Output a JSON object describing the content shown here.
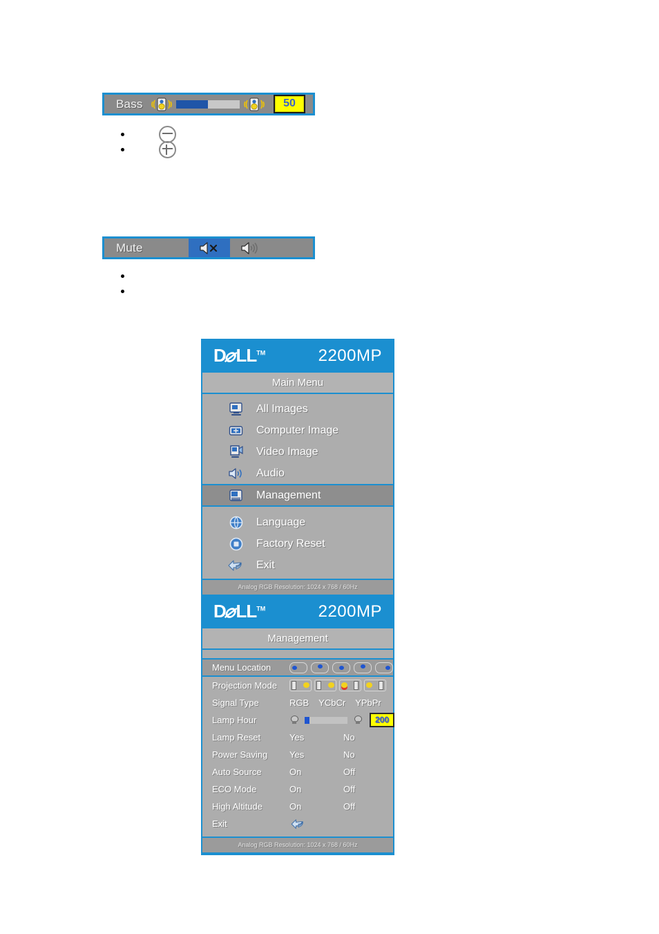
{
  "bass_control": {
    "label": "Bass",
    "value": "50",
    "fill_percent": 50,
    "left_icon": "bass-speaker-icon",
    "right_icon": "bass-speaker-icon"
  },
  "bass_bullets": [
    {
      "icon": "minus-circle-icon",
      "text": ""
    },
    {
      "icon": "plus-circle-icon",
      "text": ""
    }
  ],
  "mute_control": {
    "label": "Mute",
    "options": [
      {
        "icon": "speaker-muted-icon",
        "selected": true
      },
      {
        "icon": "speaker-on-icon",
        "selected": false
      }
    ]
  },
  "mute_bullets": [
    {
      "text": ""
    },
    {
      "text": ""
    }
  ],
  "main_menu_panel": {
    "brand": "D∕LL",
    "brand_tm": "TM",
    "model": "2200MP",
    "title": "Main Menu",
    "items": [
      {
        "label": "All Images",
        "icon": "monitor-icon",
        "selected": false
      },
      {
        "label": "Computer Image",
        "icon": "computer-image-icon",
        "selected": false
      },
      {
        "label": "Video Image",
        "icon": "video-image-icon",
        "selected": false
      },
      {
        "label": "Audio",
        "icon": "speaker-icon",
        "selected": false
      },
      {
        "label": "Management",
        "icon": "management-icon",
        "selected": true
      },
      {
        "label": "Language",
        "icon": "globe-icon",
        "selected": false
      },
      {
        "label": "Factory Reset",
        "icon": "factory-reset-icon",
        "selected": false
      },
      {
        "label": "Exit",
        "icon": "exit-arrow-icon",
        "selected": false
      }
    ],
    "footer": "Analog RGB Resolution: 1024 x 768 / 60Hz"
  },
  "management_panel": {
    "brand": "D∕LL",
    "brand_tm": "TM",
    "model": "2200MP",
    "title": "Management",
    "rows": [
      {
        "label": "Menu Location",
        "type": "location-icons",
        "selected": true
      },
      {
        "label": "Projection Mode",
        "type": "projection-icons",
        "selected": false
      },
      {
        "label": "Signal Type",
        "type": "signal",
        "options": [
          "RGB",
          "YCbCr",
          "YPbPr"
        ],
        "selected": false
      },
      {
        "label": "Lamp Hour",
        "type": "lamp",
        "value": "200",
        "fill_percent": 12,
        "selected": false
      },
      {
        "label": "Lamp Reset",
        "type": "two-option",
        "options": [
          "Yes",
          "No"
        ],
        "selected": false
      },
      {
        "label": "Power Saving",
        "type": "two-option",
        "options": [
          "Yes",
          "No"
        ],
        "selected": false
      },
      {
        "label": "Auto Source",
        "type": "two-option",
        "options": [
          "On",
          "Off"
        ],
        "selected": false
      },
      {
        "label": "ECO Mode",
        "type": "two-option",
        "options": [
          "On",
          "Off"
        ],
        "selected": false
      },
      {
        "label": "High Altitude",
        "type": "two-option",
        "options": [
          "On",
          "Off"
        ],
        "selected": false
      },
      {
        "label": "Exit",
        "type": "exit",
        "selected": false
      }
    ],
    "footer": "Analog RGB Resolution: 1024 x 768 / 60Hz"
  },
  "colors": {
    "accent_blue": "#1b8fd0",
    "panel_gray": "#adadad",
    "selected_gray": "#8e8e8e",
    "value_yellow": "#ffff00",
    "value_text_blue": "#3a63c8",
    "slider_blue": "#1f55a8"
  }
}
